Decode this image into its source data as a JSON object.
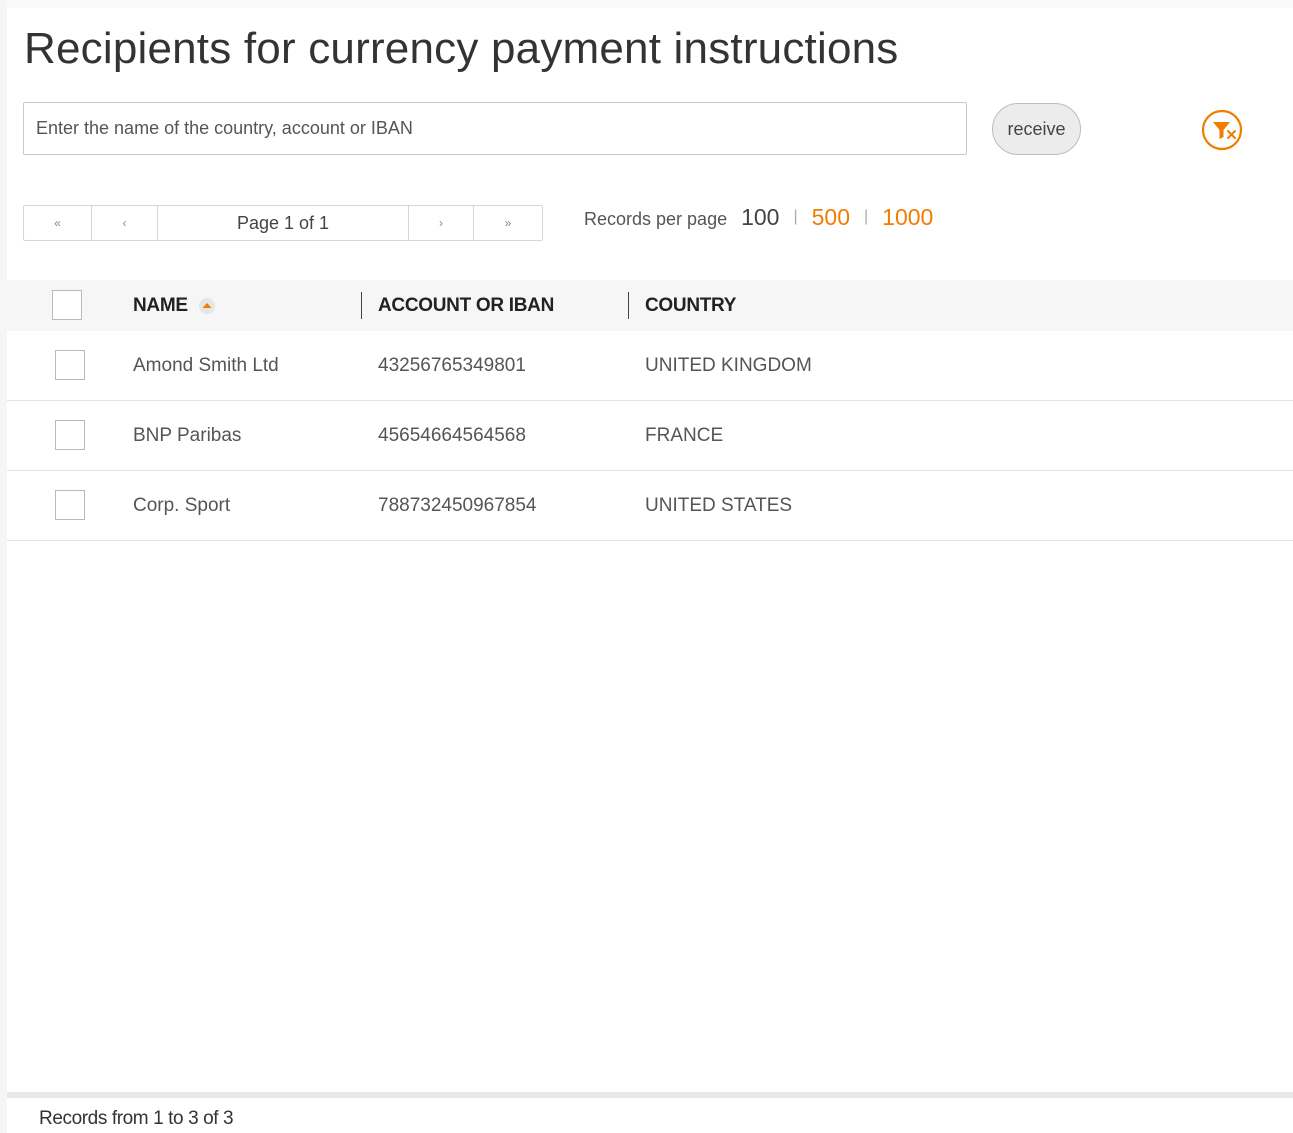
{
  "page": {
    "title": "Recipients for currency payment instructions"
  },
  "search": {
    "placeholder": "Enter the name of the country, account or IBAN",
    "value": "",
    "receive_label": "receive"
  },
  "filter_clear": {
    "icon": "filter-clear-icon",
    "color": "#f07d00"
  },
  "pager": {
    "first_symbol": "«",
    "prev_symbol": "‹",
    "info": "Page 1 of 1",
    "next_symbol": "›",
    "last_symbol": "»"
  },
  "records_per_page": {
    "label": "Records per page",
    "options": [
      {
        "value": "100",
        "active": true
      },
      {
        "value": "500",
        "active": false
      },
      {
        "value": "1000",
        "active": false
      }
    ],
    "separator": "|"
  },
  "table": {
    "columns": [
      {
        "label": "NAME",
        "sorted": "ascending"
      },
      {
        "label": "ACCOUNT OR IBAN"
      },
      {
        "label": "COUNTRY"
      }
    ],
    "rows": [
      {
        "name": "Amond Smith Ltd",
        "account": "43256765349801",
        "country": "UNITED KINGDOM"
      },
      {
        "name": "BNP Paribas",
        "account": "45654664564568",
        "country": "FRANCE"
      },
      {
        "name": "Corp. Sport",
        "account": "788732450967854",
        "country": "UNITED STATES"
      }
    ]
  },
  "footer": {
    "records_text": "Records from 1 to 3 of 3"
  },
  "colors": {
    "accent": "#f07d00",
    "header_bg": "#f6f6f6",
    "text": "#555555"
  }
}
